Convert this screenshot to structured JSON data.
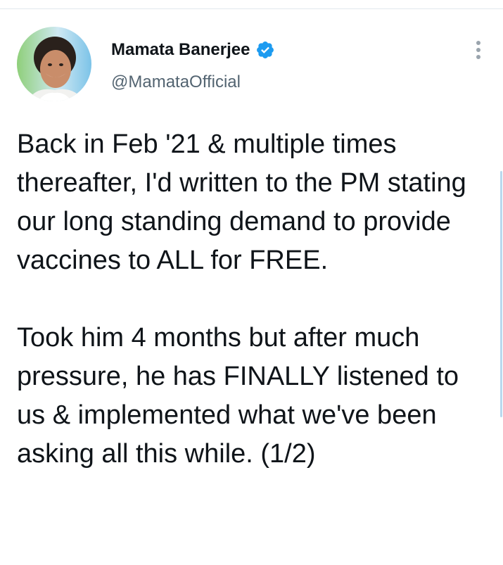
{
  "tweet": {
    "author": {
      "display_name": "Mamata Banerjee",
      "handle": "@MamataOfficial",
      "verified": true,
      "avatar_icon": "profile-photo",
      "verified_icon": "verified-badge-icon"
    },
    "menu_icon": "more-vertical-icon",
    "paragraphs": [
      "Back in Feb '21 & multiple times thereafter, I'd written to the PM stating our long standing demand to provide vaccines to ALL for FREE.",
      "Took him 4 months but after much pressure, he has FINALLY listened to us & implemented what we've been asking all this while. (1/2)"
    ]
  },
  "colors": {
    "text": "#0f1419",
    "secondary_text": "#536471",
    "verified_blue": "#1d9bf0",
    "divider": "#e1e8ed"
  }
}
